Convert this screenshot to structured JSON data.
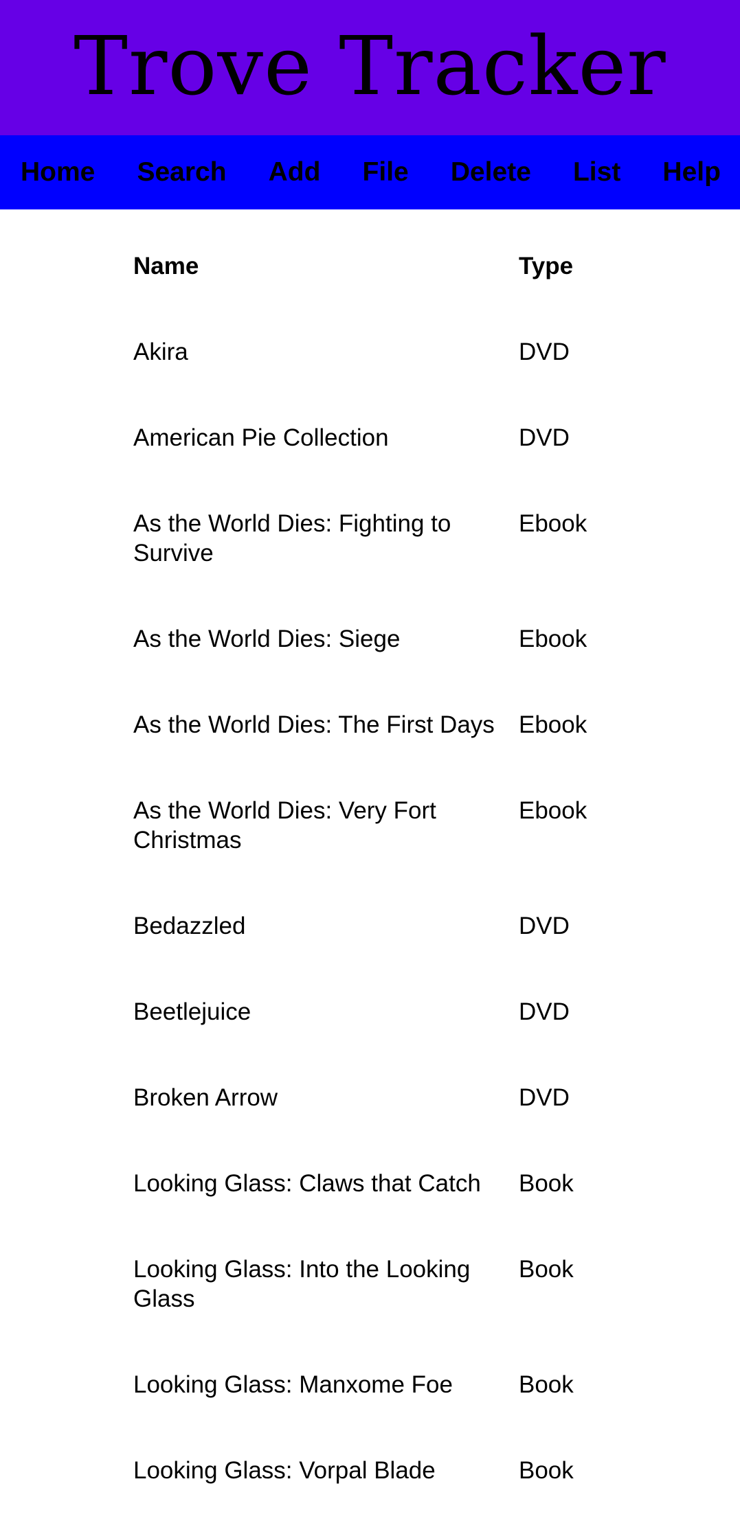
{
  "colors": {
    "header_bg": "#6600e6",
    "nav_bg": "#0000ff",
    "page_bg": "#ffffff",
    "text": "#000000"
  },
  "site": {
    "title": "Trove Tracker"
  },
  "nav": {
    "items": [
      {
        "label": "Home"
      },
      {
        "label": "Search"
      },
      {
        "label": "Add"
      },
      {
        "label": "File"
      },
      {
        "label": "Delete"
      },
      {
        "label": "List"
      },
      {
        "label": "Help"
      }
    ]
  },
  "table": {
    "headers": {
      "name": "Name",
      "type": "Type"
    },
    "rows": [
      {
        "name": "Akira",
        "type": "DVD"
      },
      {
        "name": "American Pie Collection",
        "type": "DVD"
      },
      {
        "name": "As the World Dies: Fighting to Survive",
        "type": "Ebook"
      },
      {
        "name": "As the World Dies: Siege",
        "type": "Ebook"
      },
      {
        "name": "As the World Dies: The First Days",
        "type": "Ebook"
      },
      {
        "name": "As the World Dies: Very Fort Christmas",
        "type": "Ebook"
      },
      {
        "name": "Bedazzled",
        "type": "DVD"
      },
      {
        "name": "Beetlejuice",
        "type": "DVD"
      },
      {
        "name": "Broken Arrow",
        "type": "DVD"
      },
      {
        "name": "Looking Glass: Claws that Catch",
        "type": "Book"
      },
      {
        "name": "Looking Glass: Into the Looking Glass",
        "type": "Book"
      },
      {
        "name": "Looking Glass: Manxome Foe",
        "type": "Book"
      },
      {
        "name": "Looking Glass: Vorpal Blade",
        "type": "Book"
      }
    ]
  }
}
